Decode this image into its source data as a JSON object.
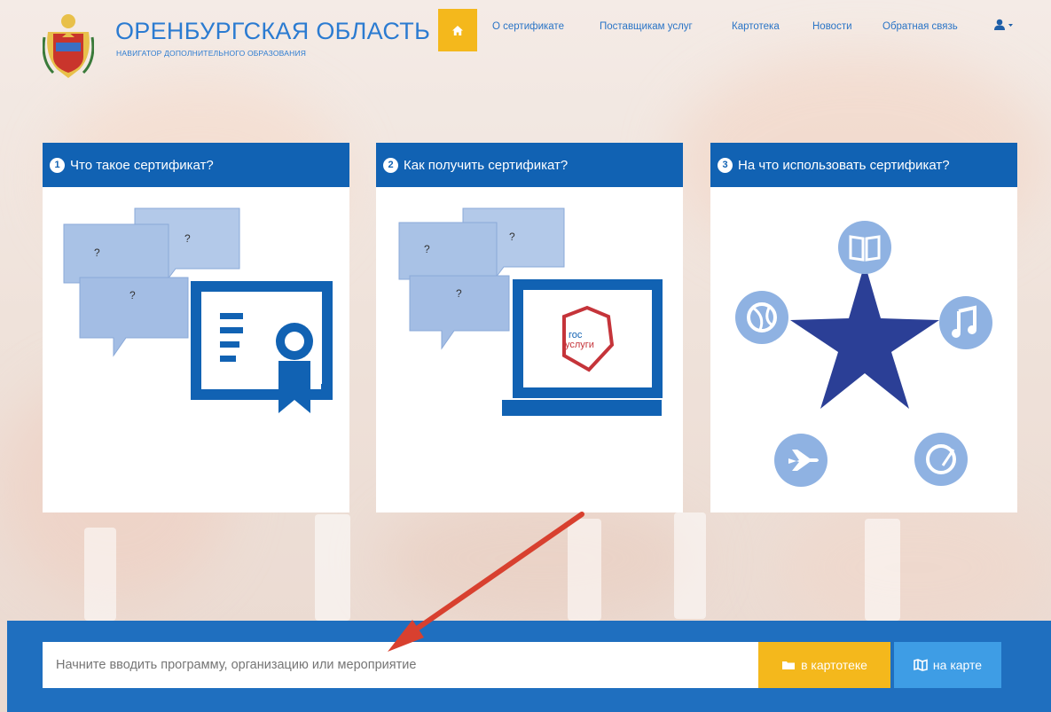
{
  "header": {
    "title": "ОРЕНБУРГСКАЯ ОБЛАСТЬ",
    "subtitle": "НАВИГАТОР ДОПОЛНИТЕЛЬНОГО ОБРАЗОВАНИЯ",
    "logo_icon": "coat-of-arms-icon",
    "home_icon": "home-icon",
    "nav": [
      {
        "label": "О сертификате"
      },
      {
        "label": "Поставщикам услуг"
      },
      {
        "label": "Картотека"
      },
      {
        "label": "Новости"
      },
      {
        "label": "Обратная связь"
      }
    ],
    "user_icon": "user-icon"
  },
  "cards": [
    {
      "num": "1",
      "title": "Что такое сертификат?",
      "icon": "certificate-icon"
    },
    {
      "num": "2",
      "title": "Как получить сертификат?",
      "icon": "laptop-gosuslugi-icon"
    },
    {
      "num": "3",
      "title": "На что использовать сертификат?",
      "icon": "star-activities-icon"
    }
  ],
  "card2_logo": {
    "line1": "гос",
    "line2": "услуги"
  },
  "search": {
    "placeholder": "Начните вводить программу, организацию или мероприятие",
    "catalog_button": "в картотеке",
    "map_button": "на карте"
  },
  "colors": {
    "primary": "#1162b3",
    "accent": "#f4b81c",
    "map": "#3e9de5",
    "arrow": "#d8402f"
  }
}
